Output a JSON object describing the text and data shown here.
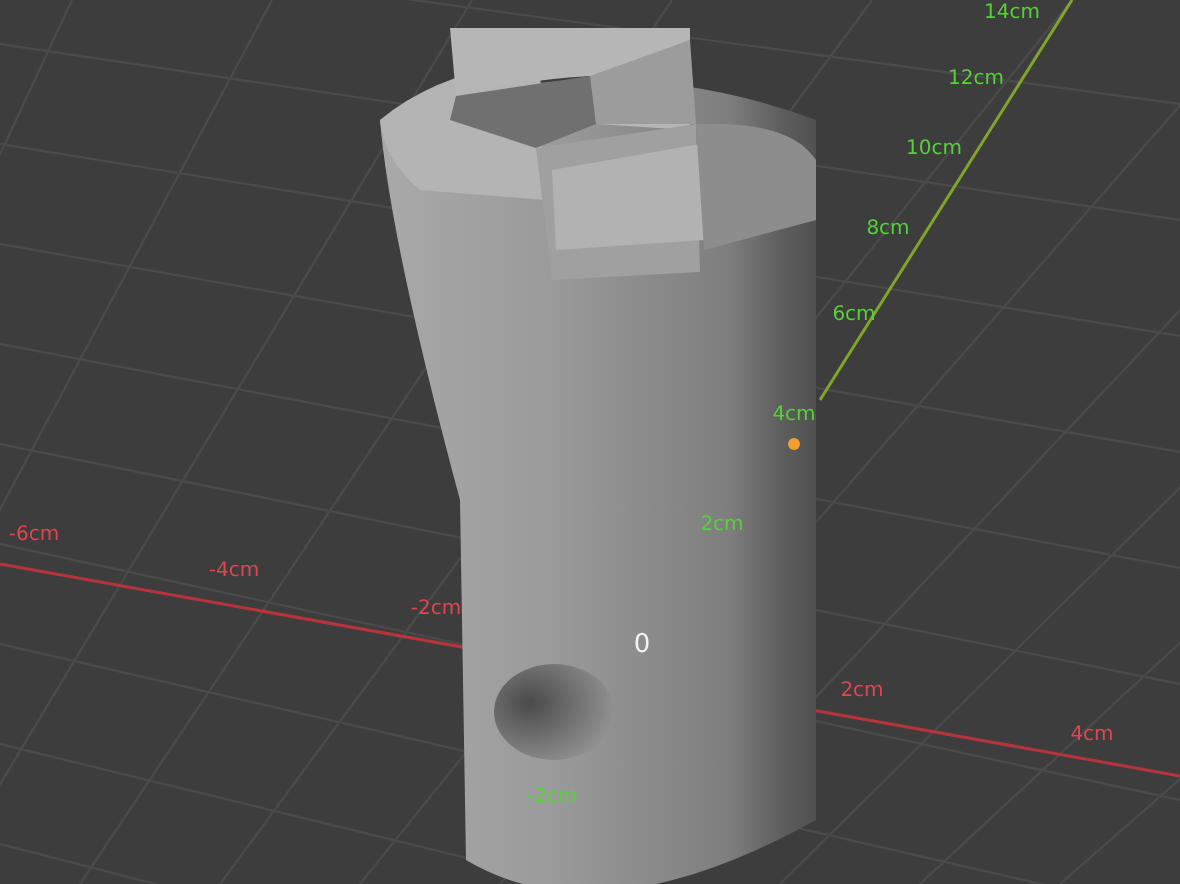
{
  "viewport": {
    "y_axis_labels": [
      "14cm",
      "12cm",
      "10cm",
      "8cm",
      "6cm",
      "4cm",
      "2cm",
      "-2cm"
    ],
    "x_axis_labels": [
      "-6cm",
      "-4cm",
      "-2cm",
      "2cm",
      "4cm"
    ],
    "origin_label": "0"
  }
}
